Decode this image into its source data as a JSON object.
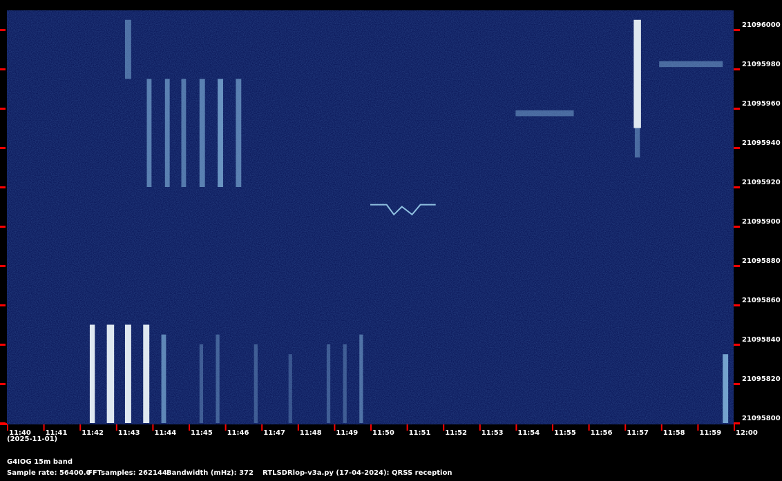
{
  "chart_data": {
    "type": "heatmap",
    "title": "QRSS spectrogram",
    "x_ticks": [
      "11:40",
      "11:41",
      "11:42",
      "11:43",
      "11:44",
      "11:45",
      "11:46",
      "11:47",
      "11:48",
      "11:49",
      "11:50",
      "11:51",
      "11:52",
      "11:53",
      "11:54",
      "11:55",
      "11:56",
      "11:57",
      "11:58",
      "11:59",
      "12:00"
    ],
    "x_range_minutes": [
      0,
      20
    ],
    "y_ticks": [
      "21096000",
      "21095980",
      "21095960",
      "21095940",
      "21095920",
      "21095900",
      "21095880",
      "21095860",
      "21095840",
      "21095820",
      "21095800"
    ],
    "y_range_hz": [
      21095800,
      21096005
    ],
    "date": "(2025-11-01)",
    "background_color": "#0c1a5c",
    "signal_color": "#dfe8f0",
    "tick_color": "#ff0000",
    "signals": [
      {
        "t0": 2.28,
        "t1": 2.42,
        "f0": 21095800,
        "f1": 21095850,
        "level": 1.0
      },
      {
        "t0": 2.75,
        "t1": 2.95,
        "f0": 21095800,
        "f1": 21095850,
        "level": 1.0
      },
      {
        "t0": 3.25,
        "t1": 3.42,
        "f0": 21095800,
        "f1": 21095850,
        "level": 0.95
      },
      {
        "t0": 3.75,
        "t1": 3.92,
        "f0": 21095800,
        "f1": 21095850,
        "level": 0.95
      },
      {
        "t0": 4.25,
        "t1": 4.38,
        "f0": 21095800,
        "f1": 21095845,
        "level": 0.6
      },
      {
        "t0": 5.3,
        "t1": 5.4,
        "f0": 21095800,
        "f1": 21095840,
        "level": 0.3
      },
      {
        "t0": 5.75,
        "t1": 5.85,
        "f0": 21095800,
        "f1": 21095845,
        "level": 0.35
      },
      {
        "t0": 6.8,
        "t1": 6.9,
        "f0": 21095800,
        "f1": 21095840,
        "level": 0.3
      },
      {
        "t0": 7.75,
        "t1": 7.85,
        "f0": 21095800,
        "f1": 21095835,
        "level": 0.25
      },
      {
        "t0": 8.8,
        "t1": 8.9,
        "f0": 21095800,
        "f1": 21095840,
        "level": 0.3
      },
      {
        "t0": 9.25,
        "t1": 9.35,
        "f0": 21095800,
        "f1": 21095840,
        "level": 0.3
      },
      {
        "t0": 9.7,
        "t1": 9.8,
        "f0": 21095800,
        "f1": 21095845,
        "level": 0.45
      },
      {
        "t0": 3.85,
        "t1": 3.98,
        "f0": 21095920,
        "f1": 21095975,
        "level": 0.55
      },
      {
        "t0": 4.35,
        "t1": 4.48,
        "f0": 21095920,
        "f1": 21095975,
        "level": 0.55
      },
      {
        "t0": 4.8,
        "t1": 4.93,
        "f0": 21095920,
        "f1": 21095975,
        "level": 0.5
      },
      {
        "t0": 5.3,
        "t1": 5.45,
        "f0": 21095920,
        "f1": 21095975,
        "level": 0.55
      },
      {
        "t0": 5.8,
        "t1": 5.95,
        "f0": 21095920,
        "f1": 21095975,
        "level": 0.7
      },
      {
        "t0": 6.3,
        "t1": 6.45,
        "f0": 21095920,
        "f1": 21095975,
        "level": 0.55
      },
      {
        "t0": 3.25,
        "t1": 3.42,
        "f0": 21095975,
        "f1": 21096005,
        "level": 0.45
      },
      {
        "t0": 17.25,
        "t1": 17.45,
        "f0": 21095950,
        "f1": 21096005,
        "level": 1.0
      },
      {
        "t0": 17.28,
        "t1": 17.42,
        "f0": 21095935,
        "f1": 21095950,
        "level": 0.4
      },
      {
        "t0": 14.0,
        "t1": 15.6,
        "f0": 21095956,
        "f1": 21095959,
        "level": 0.4
      },
      {
        "t0": 17.95,
        "t1": 19.7,
        "f0": 21095981,
        "f1": 21095984,
        "level": 0.4
      },
      {
        "t0": 19.7,
        "t1": 19.85,
        "f0": 21095800,
        "f1": 21095835,
        "level": 0.8
      }
    ],
    "trace": [
      [
        10.0,
        21095911
      ],
      [
        10.45,
        21095911
      ],
      [
        10.65,
        21095906
      ],
      [
        10.87,
        21095910
      ],
      [
        11.15,
        21095906
      ],
      [
        11.38,
        21095911
      ],
      [
        11.8,
        21095911
      ]
    ]
  },
  "footer": {
    "station": "G4IOG 15m band",
    "sample_rate": "Sample rate: 56400.0",
    "fft_samples": "FFTsamples: 262144",
    "bandwidth": "Bandwidth (mHz): 372",
    "software": "RTLSDRlop-v3a.py (17-04-2024): QRSS reception"
  }
}
